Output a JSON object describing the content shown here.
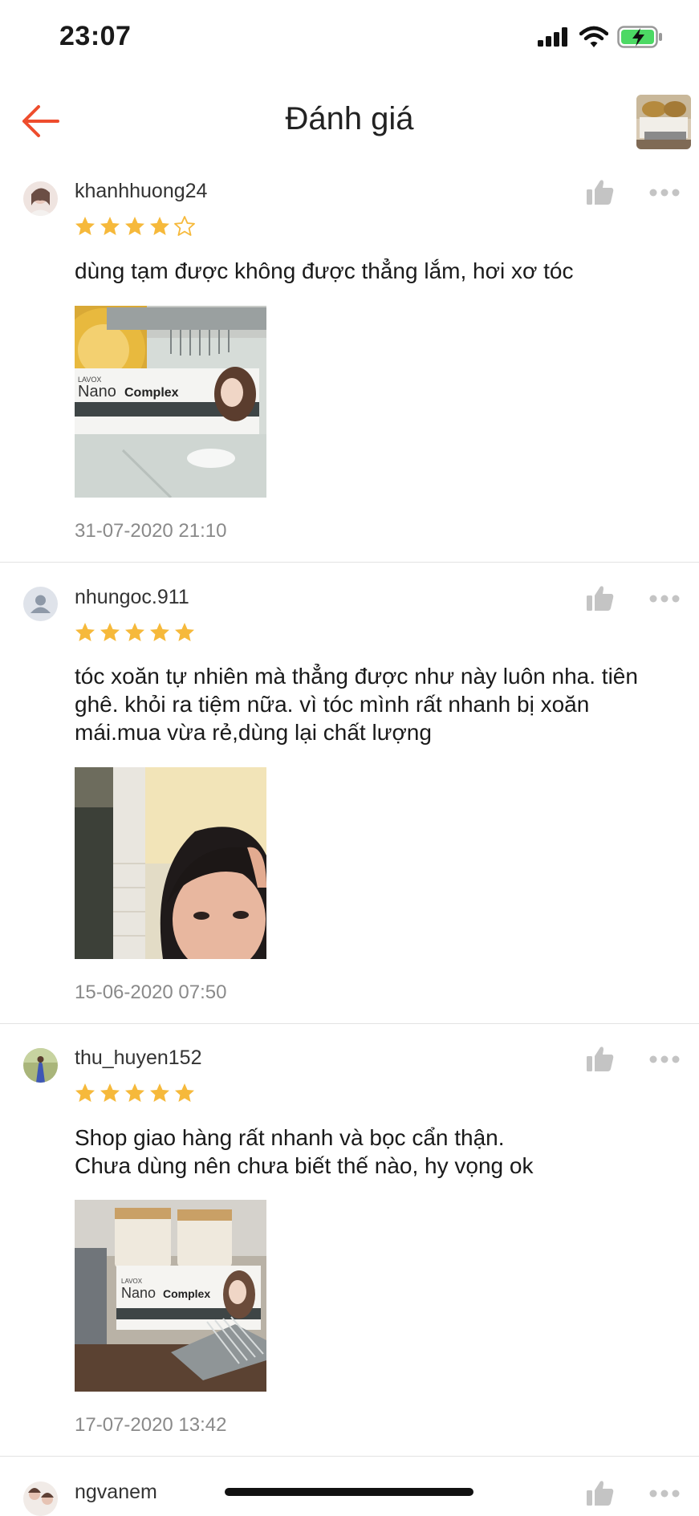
{
  "status_bar": {
    "time": "23:07"
  },
  "header": {
    "title": "Đánh giá",
    "back_icon": "arrow-left-icon"
  },
  "colors": {
    "accent": "#ee4d2d",
    "star": "#f6b93b",
    "meta_gray": "#8a8a8a",
    "icon_gray": "#c4c4c4"
  },
  "reviews": [
    {
      "username": "khanhhuong24",
      "rating": 4,
      "max_rating": 5,
      "comment": "dùng tạm được không được thẳng lắm, hơi xơ tóc",
      "date": "31-07-2020 21:10",
      "photo_text": {
        "brand": "LAVOX",
        "line1": "Nano",
        "line2": "Complex"
      }
    },
    {
      "username": "nhungoc.911",
      "rating": 5,
      "max_rating": 5,
      "comment": "tóc xoăn tự nhiên mà thẳng được như này luôn nha. tiên\nghê. khỏi ra tiệm nữa. vì tóc mình rất nhanh bị xoăn\nmái.mua vừa rẻ,dùng lại chất lượng",
      "date": "15-06-2020 07:50"
    },
    {
      "username": "thu_huyen152",
      "rating": 5,
      "max_rating": 5,
      "comment": "Shop giao hàng rất nhanh và bọc cẩn thận.\nChưa dùng nên chưa biết thế nào, hy vọng ok",
      "date": "17-07-2020 13:42",
      "photo_text": {
        "brand": "LAVOX",
        "line1": "Nano",
        "line2": "Complex"
      }
    },
    {
      "username": "ngvanem"
    }
  ]
}
